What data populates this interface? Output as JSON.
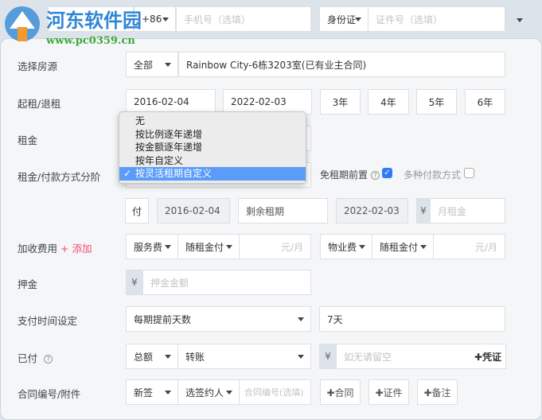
{
  "watermark": {
    "name": "河东软件园",
    "url": "www.pc0359.cn"
  },
  "top": {
    "country_code": "+86",
    "phone_placeholder": "手机号（选填）",
    "id_type": "身份证",
    "id_placeholder": "证件号（选填）"
  },
  "house": {
    "label": "选择房源",
    "filter": "全部",
    "value": "Rainbow City-6栋3203室(已有业主合同)"
  },
  "term": {
    "label": "起租/退租",
    "start": "2016-02-04",
    "end": "2022-02-03",
    "quick": [
      "3年",
      "4年",
      "5年",
      "6年"
    ]
  },
  "rent": {
    "label": "租金"
  },
  "stage": {
    "label": "租金/付款方式分阶",
    "free_period": "免租期前置",
    "free_period_checked": true,
    "multi_pay": "多种付款方式",
    "multi_pay_checked": false
  },
  "dropdown": {
    "options": [
      "无",
      "按比例逐年递增",
      "按金额逐年递增",
      "按年自定义",
      "按灵活租期自定义"
    ],
    "selected_index": 4,
    "check": "✓"
  },
  "pay_row": {
    "pay": "付",
    "start": "2016-02-04",
    "remaining": "剩余租期",
    "end": "2022-02-03",
    "currency": "¥",
    "monthly_placeholder": "月租金"
  },
  "extra": {
    "label": "加收费用",
    "add": "+ 添加",
    "fee1": "服务费",
    "fee1_mode": "随租金付",
    "fee1_unit": "元/月",
    "fee2": "物业费",
    "fee2_mode": "随租金付",
    "fee2_unit": "元/月"
  },
  "deposit": {
    "label": "押金",
    "currency": "¥",
    "placeholder": "押金金额"
  },
  "paytime": {
    "label": "支付时间设定",
    "mode": "每期提前天数",
    "days": "7天"
  },
  "paid": {
    "label": "已付",
    "help": "?",
    "type": "总额",
    "method": "转账",
    "currency": "¥",
    "placeholder": "如无请留空",
    "voucher": "✚凭证"
  },
  "contract": {
    "label": "合同编号/附件",
    "kind": "新签",
    "signer": "选签约人",
    "number_placeholder": "合同编号(选填)",
    "add_contract": "✚合同",
    "add_cert": "✚证件",
    "add_note": "✚备注"
  }
}
